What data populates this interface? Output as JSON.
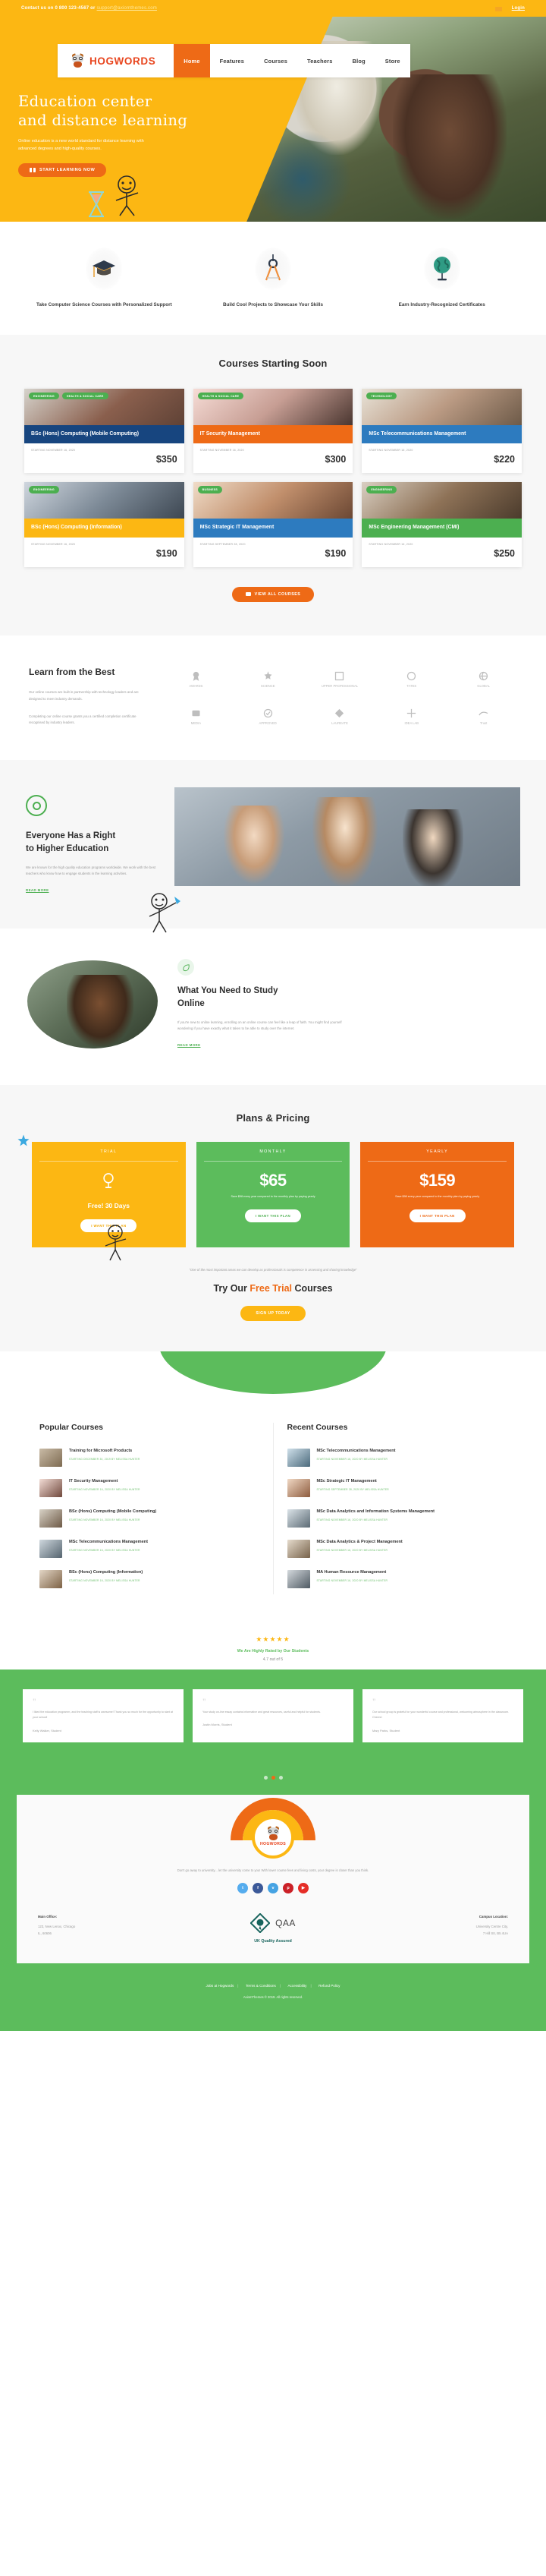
{
  "topbar": {
    "contact_prefix": "Contact us on 0 800 123-4567 or",
    "email": "support@axiomthemes.com",
    "login": "Login",
    "cart_icon": "cart-icon"
  },
  "header": {
    "brand": "HOGWORDS",
    "nav": [
      {
        "label": "Home",
        "active": true
      },
      {
        "label": "Features",
        "active": false
      },
      {
        "label": "Courses",
        "active": false
      },
      {
        "label": "Teachers",
        "active": false
      },
      {
        "label": "Blog",
        "active": false
      },
      {
        "label": "Store",
        "active": false
      }
    ],
    "search_icon": "search-icon"
  },
  "hero": {
    "title_line1": "Education center",
    "title_line2": "and distance learning",
    "subtitle": "Online education is a new world standard for distance learning with advanced degrees and high-quality courses.",
    "button": "START LEARNING NOW"
  },
  "features": [
    {
      "icon": "graduation-cap-icon",
      "label": "Take Computer Science Courses with Personalized Support"
    },
    {
      "icon": "compass-icon",
      "label": "Build Cool Projects to Showcase Your Skills"
    },
    {
      "icon": "globe-icon",
      "label": "Earn Industry-Recognized Certificates"
    }
  ],
  "courses_section": {
    "title": "Courses Starting Soon",
    "view_all": "VIEW ALL COURSES",
    "cards": [
      {
        "tags": [
          "ENGINEERING",
          "HEALTH & SOCIAL CARE"
        ],
        "title": "BSc (Hons) Computing (Mobile Computing)",
        "meta": "STARTING NOVEMBER 16, 2020",
        "price": "$350",
        "color": "c-navy"
      },
      {
        "tags": [
          "HEALTH & SOCIAL CARE"
        ],
        "title": "IT Security Management",
        "meta": "STARTING NOVEMBER 16, 2020",
        "price": "$300",
        "color": "c-orange"
      },
      {
        "tags": [
          "TECHNOLOGY"
        ],
        "title": "MSc Telecommunications Management",
        "meta": "STARTING NOVEMBER 16, 2020",
        "price": "$220",
        "color": "c-blue"
      },
      {
        "tags": [
          "ENGINEERING"
        ],
        "title": "BSc (Hons) Computing (Information)",
        "meta": "STARTING NOVEMBER 16, 2020",
        "price": "$190",
        "color": "c-yellow"
      },
      {
        "tags": [
          "BUSINESS"
        ],
        "title": "MSc Strategic IT Management",
        "meta": "STARTING SEPTEMBER 28, 2020",
        "price": "$190",
        "color": "c-blue"
      },
      {
        "tags": [
          "ENGINEERING"
        ],
        "title": "MSc Engineering Management (CMI)",
        "meta": "STARTING NOVEMBER 16, 2020",
        "price": "$250",
        "color": "c-green"
      }
    ]
  },
  "learn": {
    "title": "Learn from the Best",
    "paragraph1": "Our online courses are built in partnership with technology leaders and are designed to meet industry demands.",
    "paragraph2": "Completing our online course grants you a certified completion certificate recognised by industry leaders.",
    "logos": [
      "AWARDS",
      "SCIENCE",
      "UPPER PROFESSIONAL",
      "TATES",
      "GLOBAL",
      "MEDIA",
      "APPROVED",
      "LAUREATE",
      "IDEA LAB",
      "Trust"
    ]
  },
  "right_education": {
    "icon": "target-icon",
    "title_line1": "Everyone Has a Right",
    "title_line2": "to Higher Education",
    "paragraph": "We are known for the high quality education programs worldwide. We work with the best teachers who know how to engage students in the learning activities.",
    "readmore": "READ MORE"
  },
  "study_online": {
    "icon": "leaf-icon",
    "title_line1": "What You Need to Study",
    "title_line2": "Online",
    "paragraph": "If you're new to online learning, enrolling on an online course can feel like a leap of faith. You might find yourself wondering if you have exactly what it takes to be able to study over the internet.",
    "readmore": "READ MORE"
  },
  "pricing": {
    "title": "Plans & Pricing",
    "plans": [
      {
        "name": "TRIAL",
        "icon": "globe-icon",
        "amount": "",
        "highlight": "Free! 30 Days",
        "note": "",
        "button": "I WANT THIS PLAN"
      },
      {
        "name": "MONTHLY",
        "icon": "",
        "amount": "$65",
        "highlight": "",
        "note": "Save $98 every year compared to the monthly plan by paying yearly",
        "button": "I WANT THIS PLAN"
      },
      {
        "name": "YEARLY",
        "icon": "",
        "amount": "$159",
        "highlight": "",
        "note": "Save $98 every year compared to the monthly plan by paying yearly",
        "button": "I WANT THIS PLAN"
      }
    ],
    "quote": "\"One of the most important areas we can develop as professionals is competence in assessing and sharing knowledge\"",
    "cta_pre": "Try Our",
    "cta_hl": "Free Trial",
    "cta_post": "Courses",
    "signup": "SIGN UP TODAY"
  },
  "popular_courses": {
    "title": "Popular Courses",
    "items": [
      {
        "title": "Training for Microsoft Products",
        "meta": "STARTING DECEMBER 30, 2019 BY MELISSA HUNTER"
      },
      {
        "title": "IT Security Management",
        "meta": "STARTING NOVEMBER 16, 2020 BY MELISSA HUNTER"
      },
      {
        "title": "BSc (Hons) Computing (Mobile Computing)",
        "meta": "STARTING NOVEMBER 16, 2020 BY MELISSA HUNTER"
      },
      {
        "title": "MSc Telecommunications Management",
        "meta": "STARTING NOVEMBER 16, 2020 BY MELISSA HUNTER"
      },
      {
        "title": "BSc (Hons) Computing (Information)",
        "meta": "STARTING NOVEMBER 16, 2020 BY MELISSA HUNTER"
      }
    ]
  },
  "recent_courses": {
    "title": "Recent Courses",
    "items": [
      {
        "title": "MSc Telecommunications Management",
        "meta": "STARTING NOVEMBER 16, 2020 BY MELISSA HUNTER"
      },
      {
        "title": "MSc Strategic IT Management",
        "meta": "STARTING SEPTEMBER 28, 2020 BY MELISSA HUNTER"
      },
      {
        "title": "MSc Data Analytics and Information Systems Management",
        "meta": "STARTING NOVEMBER 16, 2020 BY MELISSA HUNTER"
      },
      {
        "title": "MSc Data Analytics & Project Management",
        "meta": "STARTING NOVEMBER 16, 2020 BY MELISSA HUNTER"
      },
      {
        "title": "MA Human Resource Management",
        "meta": "STARTING NOVEMBER 16, 2020 BY MELISSA HUNTER"
      }
    ]
  },
  "rating": {
    "stars": "★★★★★",
    "headline": "We Are Highly Rated by Our Students",
    "score": "4.7 out of 5"
  },
  "testimonials": [
    {
      "quote": "I liked the education programm, and the teaching staff is awesome! Thank you so much for the opportunity to start at your school!",
      "name": "Kelly Walker,",
      "role": " Student"
    },
    {
      "quote": "Your study on-line essay contains informative and great resources, useful and helpful for students.",
      "name": "Justin Morris,",
      "role": " Student"
    },
    {
      "quote": "Our school group is grateful for your wonderful course and professional, welcoming atmosphere in the classroom. Cheers!",
      "name": "Mary Parks,",
      "role": " Student"
    }
  ],
  "footer": {
    "brand": "HOGWORDS",
    "tagline": "Don't go away to university... let the university come to you! With lower course fees and living costs, your degree is closer than you think.",
    "socials": [
      "twitter-icon",
      "facebook-icon",
      "vk-icon",
      "pinterest-icon",
      "youtube-icon"
    ],
    "main_office_label": "Main Office:",
    "main_office_line1": "123, New Lenox, Chicago",
    "main_office_line2": "IL, 60606",
    "qaa_word": "QAA",
    "qaa_sub": "UK Quality Assured",
    "campus_label": "Campus Location:",
    "campus_line1": "University Centre City,",
    "campus_line2": "7 Hill Str, B5 4UA",
    "links": [
      "Jobs at Hogwords",
      "Terms & Conditions",
      "Accessibility",
      "Refund Policy"
    ],
    "copyright": "AxiomThemes © 2019. All rights reserved."
  }
}
